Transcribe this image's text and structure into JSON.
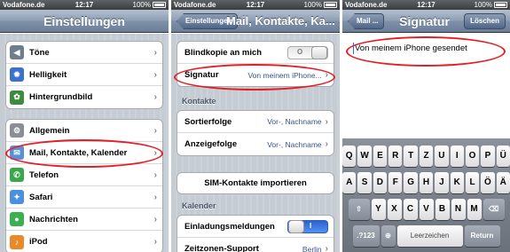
{
  "status": {
    "carrier": "Vodafone.de",
    "time": "12:17",
    "battery": "100%"
  },
  "panel1": {
    "nav_title": "Einstellungen",
    "group1": [
      {
        "label": "Töne",
        "icon": "speaker-icon",
        "color": "#6f7d8e",
        "glyph": "◀"
      },
      {
        "label": "Helligkeit",
        "icon": "sun-icon",
        "color": "#3a72c9",
        "glyph": "✹"
      },
      {
        "label": "Hintergrundbild",
        "icon": "flower-icon",
        "color": "#3d8b3d",
        "glyph": "✿"
      }
    ],
    "group2": [
      {
        "label": "Allgemein",
        "icon": "gear-icon",
        "color": "#8a8f96",
        "glyph": "⚙"
      },
      {
        "label": "Mail, Kontakte, Kalender",
        "icon": "mail-icon",
        "color": "#5b8fd6",
        "glyph": "✉"
      },
      {
        "label": "Telefon",
        "icon": "phone-icon",
        "color": "#3aa84a",
        "glyph": "✆"
      },
      {
        "label": "Safari",
        "icon": "compass-icon",
        "color": "#4a8fe0",
        "glyph": "✦"
      },
      {
        "label": "Nachrichten",
        "icon": "speech-bubble-icon",
        "color": "#3cb050",
        "glyph": "●"
      },
      {
        "label": "iPod",
        "icon": "music-note-icon",
        "color": "#e98a28",
        "glyph": "♪"
      }
    ]
  },
  "panel2": {
    "back_label": "Einstellungen",
    "nav_title": "Mail, Kontakte, Ka...",
    "blindkopie_label": "Blindkopie an mich",
    "toggle_off_text": "O",
    "signatur_label": "Signatur",
    "signatur_value": "Von meinem iPhone...",
    "kontakte_header": "Kontakte",
    "sortierfolge_label": "Sortierfolge",
    "sortierfolge_value": "Vor-, Nachname",
    "anzeigefolge_label": "Anzeigefolge",
    "anzeigefolge_value": "Vor-, Nachname",
    "sim_button": "SIM-Kontakte importieren",
    "kalender_header": "Kalender",
    "einladung_label": "Einladungsmeldungen",
    "toggle_on_text": "I",
    "zeitzonen_label": "Zeitzonen-Support",
    "zeitzonen_value": "Berlin"
  },
  "panel3": {
    "back_label": "Mail ...",
    "nav_title": "Signatur",
    "delete_label": "Löschen",
    "signature_text": "Von meinem iPhone gesendet",
    "keyboard": {
      "row1": [
        "Q",
        "W",
        "E",
        "R",
        "T",
        "Z",
        "U",
        "I",
        "O",
        "P",
        "Ü"
      ],
      "row2": [
        "A",
        "S",
        "D",
        "F",
        "G",
        "H",
        "J",
        "K",
        "L",
        "Ö",
        "Ä"
      ],
      "row3": [
        "Y",
        "X",
        "C",
        "V",
        "B",
        "N",
        "M"
      ],
      "shift_glyph": "⇧",
      "delete_glyph": "⌫",
      "numbers": ".?123",
      "globe_glyph": "⊕",
      "space": "Leerzeichen",
      "return": "Return"
    }
  },
  "colors": {
    "accent_red": "#e31e24",
    "value_blue": "#385487"
  }
}
